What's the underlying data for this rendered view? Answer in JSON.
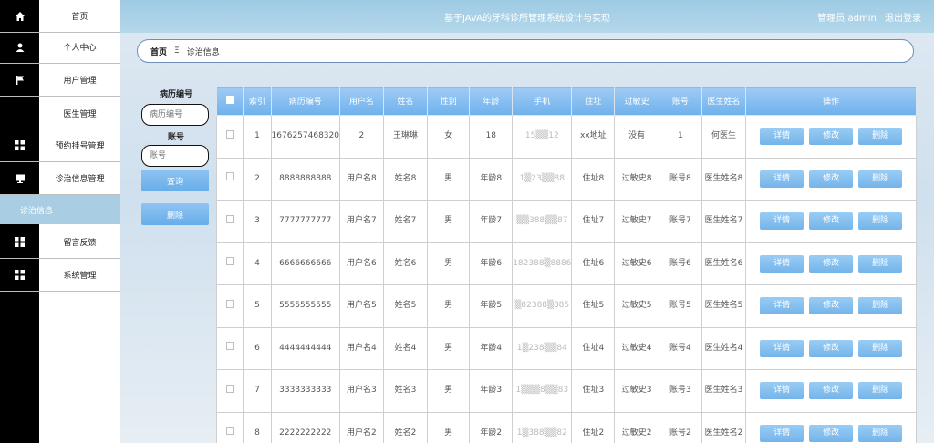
{
  "header": {
    "title": "基于JAVA的牙科诊所管理系统设计与实现",
    "user_label": "管理员 admin",
    "logout": "退出登录"
  },
  "sidebar": {
    "items": [
      {
        "label": "首页",
        "icon": "home-icon"
      },
      {
        "label": "个人中心",
        "icon": "user-icon"
      },
      {
        "label": "用户管理",
        "icon": "flag-icon"
      },
      {
        "label": "医生管理",
        "icon": ""
      },
      {
        "label": "预约挂号管理",
        "icon": "grid-icon"
      },
      {
        "label": "诊治信息管理",
        "icon": "monitor-icon"
      },
      {
        "label": "诊治信息",
        "icon": ""
      },
      {
        "label": "留言反馈",
        "icon": "grid-icon"
      },
      {
        "label": "系统管理",
        "icon": "grid-icon"
      }
    ]
  },
  "breadcrumb": {
    "home": "首页",
    "sep": "Ξ",
    "current": "诊治信息"
  },
  "search": {
    "field1_label": "病历编号",
    "field1_placeholder": "病历编号",
    "field2_label": "账号",
    "field2_placeholder": "账号",
    "query_button": "查询",
    "delete_button": "删除"
  },
  "table": {
    "columns": [
      "索引",
      "病历编号",
      "用户名",
      "姓名",
      "性别",
      "年龄",
      "手机",
      "住址",
      "过敏史",
      "账号",
      "医生姓名",
      "操作"
    ],
    "actions": {
      "detail": "详情",
      "edit": "修改",
      "delete": "删除"
    },
    "rows": [
      [
        "1",
        "1676257468320",
        "2",
        "王琳琳",
        "女",
        "18",
        "15▒▒12",
        "xx地址",
        "没有",
        "1",
        "何医生"
      ],
      [
        "2",
        "8888888888",
        "用户名8",
        "姓名8",
        "男",
        "年龄8",
        "1▒23▒▒88",
        "住址8",
        "过敏史8",
        "账号8",
        "医生姓名8"
      ],
      [
        "3",
        "7777777777",
        "用户名7",
        "姓名7",
        "男",
        "年龄7",
        "▒▒388▒▒87",
        "住址7",
        "过敏史7",
        "账号7",
        "医生姓名7"
      ],
      [
        "4",
        "6666666666",
        "用户名6",
        "姓名6",
        "男",
        "年龄6",
        "182388▒8886",
        "住址6",
        "过敏史6",
        "账号6",
        "医生姓名6"
      ],
      [
        "5",
        "5555555555",
        "用户名5",
        "姓名5",
        "男",
        "年龄5",
        "▒82388▒885",
        "住址5",
        "过敏史5",
        "账号5",
        "医生姓名5"
      ],
      [
        "6",
        "4444444444",
        "用户名4",
        "姓名4",
        "男",
        "年龄4",
        "1▒238▒▒84",
        "住址4",
        "过敏史4",
        "账号4",
        "医生姓名4"
      ],
      [
        "7",
        "3333333333",
        "用户名3",
        "姓名3",
        "男",
        "年龄3",
        "1▒▒▒8▒▒83",
        "住址3",
        "过敏史3",
        "账号3",
        "医生姓名3"
      ],
      [
        "8",
        "2222222222",
        "用户名2",
        "姓名2",
        "男",
        "年龄2",
        "1▒388▒▒82",
        "住址2",
        "过敏史2",
        "账号2",
        "医生姓名2"
      ]
    ]
  }
}
